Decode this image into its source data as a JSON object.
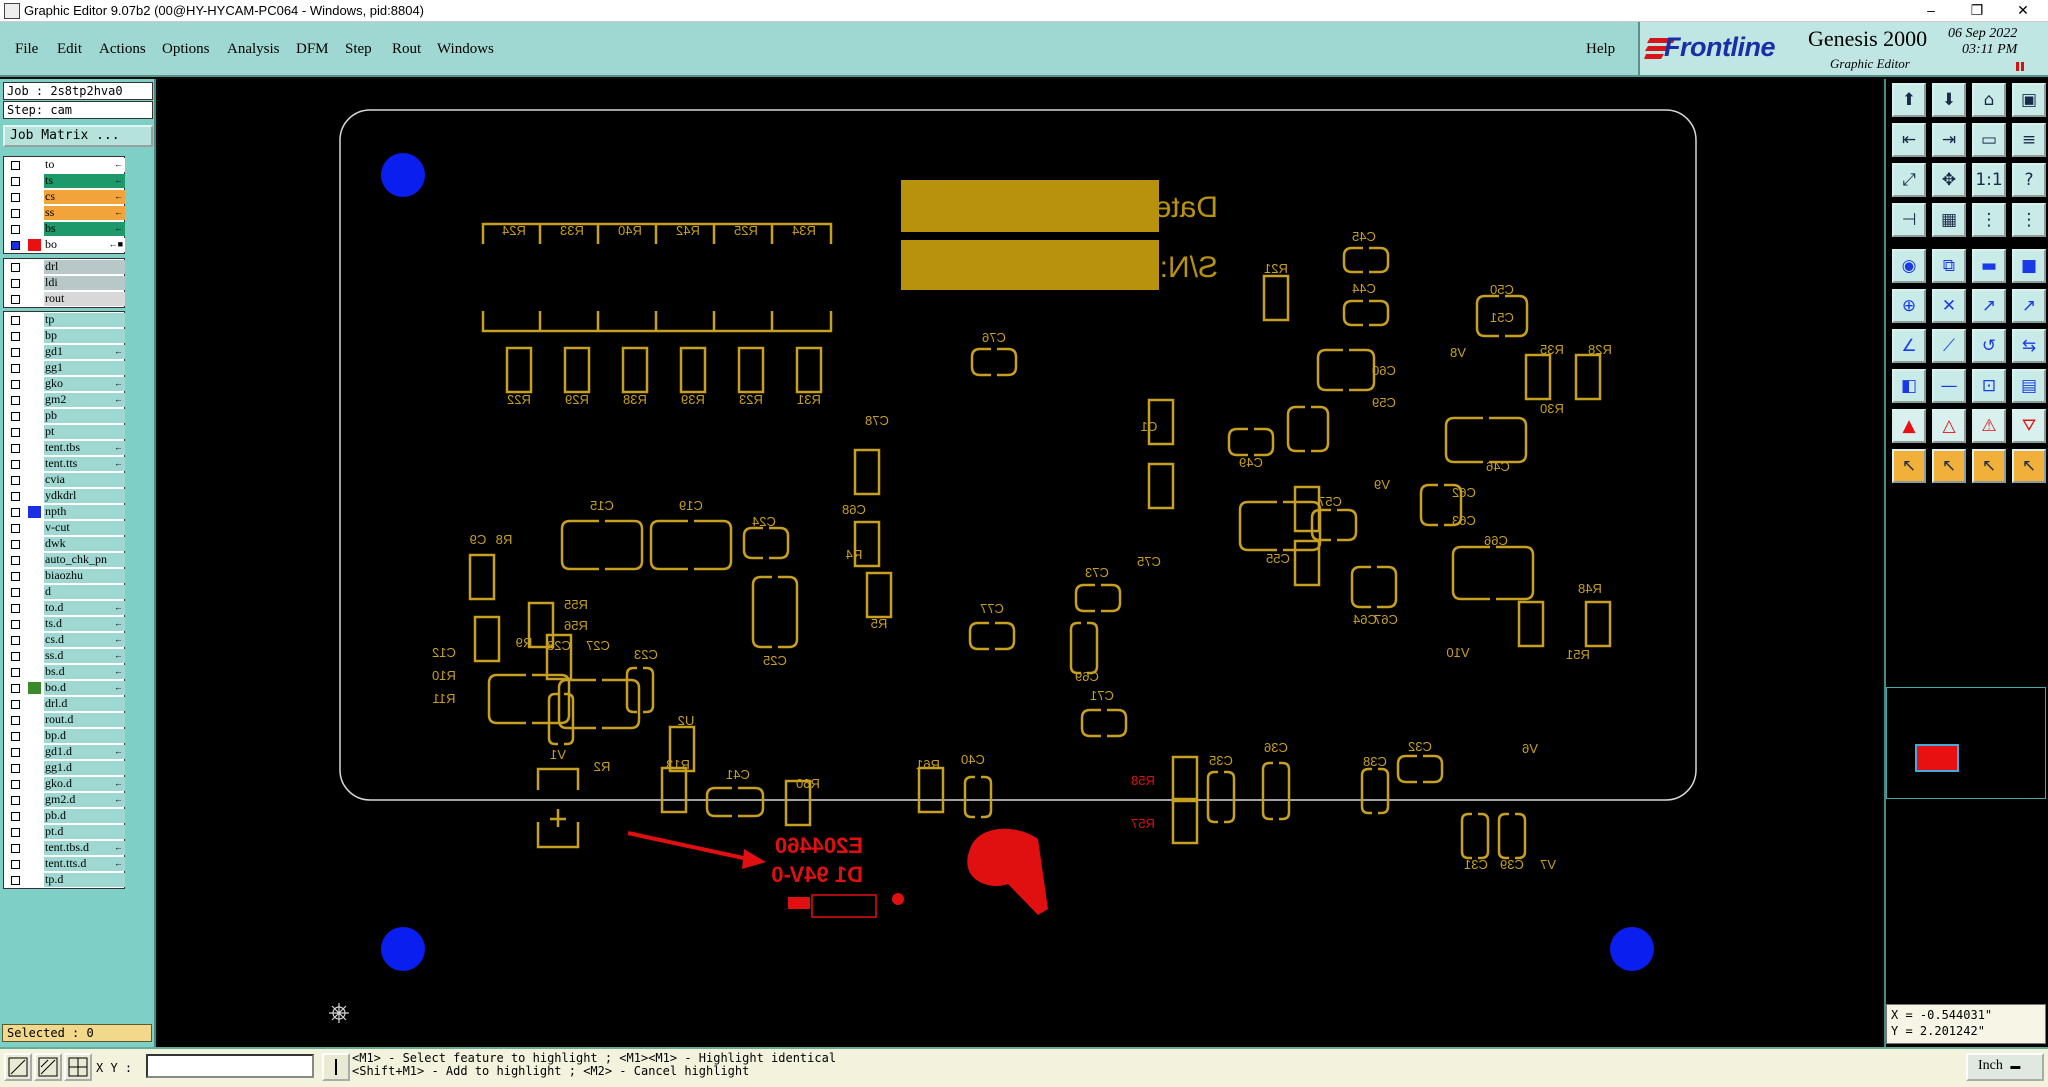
{
  "window": {
    "title": "Graphic Editor 9.07b2 (00@HY-HYCAM-PC064 - Windows, pid:8804)",
    "minimize": "–",
    "restore": "❐",
    "close": "✕"
  },
  "menu": {
    "items": [
      "File",
      "Edit",
      "Actions",
      "Options",
      "Analysis",
      "DFM",
      "Step",
      "Rout",
      "Windows"
    ],
    "help": "Help"
  },
  "brand": {
    "logo": "Frontline",
    "product": "Genesis 2000",
    "subtitle": "Graphic Editor",
    "date": "06 Sep 2022",
    "time": "03:11 PM",
    "pause_icon": "pause-icon"
  },
  "job": {
    "job_label": "Job : 2s8tp2hva0",
    "step_label": "Step: cam",
    "matrix_button": "Job Matrix ..."
  },
  "layers": {
    "group1": [
      {
        "name": "to",
        "color": "#ffffff",
        "flag": "←"
      },
      {
        "name": "ts",
        "color": "#1e9a6a",
        "flag": "←"
      },
      {
        "name": "cs",
        "color": "#f2a43a",
        "flag": "←"
      },
      {
        "name": "ss",
        "color": "#f2a43a",
        "flag": "←"
      },
      {
        "name": "bs",
        "color": "#1e9a6a",
        "flag": "←"
      },
      {
        "name": "bo",
        "color": "#ffffff",
        "flag": "←■",
        "active": true,
        "swatch": "#e81010"
      }
    ],
    "group2": [
      {
        "name": "drl",
        "color": "#b8c8c8"
      },
      {
        "name": "ldi",
        "color": "#b8c8c8"
      },
      {
        "name": "rout",
        "color": "#d8d8d8"
      }
    ],
    "group3": [
      {
        "name": "tp",
        "color": "#9fd8d2",
        "flag": ""
      },
      {
        "name": "bp",
        "color": "#9fd8d2",
        "flag": ""
      },
      {
        "name": "gd1",
        "color": "#9fd8d2",
        "flag": "←"
      },
      {
        "name": "gg1",
        "color": "#9fd8d2",
        "flag": ""
      },
      {
        "name": "gko",
        "color": "#9fd8d2",
        "flag": "←"
      },
      {
        "name": "gm2",
        "color": "#9fd8d2",
        "flag": "←"
      },
      {
        "name": "pb",
        "color": "#9fd8d2",
        "flag": ""
      },
      {
        "name": "pt",
        "color": "#9fd8d2",
        "flag": ""
      },
      {
        "name": "tent.tbs",
        "color": "#9fd8d2",
        "flag": "←"
      },
      {
        "name": "tent.tts",
        "color": "#9fd8d2",
        "flag": "←"
      },
      {
        "name": "cvia",
        "color": "#9fd8d2",
        "flag": ""
      },
      {
        "name": "ydkdrl",
        "color": "#9fd8d2",
        "flag": ""
      },
      {
        "name": "npth",
        "color": "#9fd8d2",
        "flag": "",
        "swatch": "#1a2ee8"
      },
      {
        "name": "v-cut",
        "color": "#9fd8d2",
        "flag": ""
      },
      {
        "name": "dwk",
        "color": "#9fd8d2",
        "flag": ""
      },
      {
        "name": "auto_chk_pn",
        "color": "#9fd8d2",
        "flag": ""
      },
      {
        "name": "biaozhu",
        "color": "#9fd8d2",
        "flag": ""
      },
      {
        "name": "d",
        "color": "#9fd8d2",
        "flag": ""
      },
      {
        "name": "to.d",
        "color": "#9fd8d2",
        "flag": "←"
      },
      {
        "name": "ts.d",
        "color": "#9fd8d2",
        "flag": "←"
      },
      {
        "name": "cs.d",
        "color": "#9fd8d2",
        "flag": "←"
      },
      {
        "name": "ss.d",
        "color": "#9fd8d2",
        "flag": "←"
      },
      {
        "name": "bs.d",
        "color": "#9fd8d2",
        "flag": "←"
      },
      {
        "name": "bo.d",
        "color": "#9fd8d2",
        "flag": "←",
        "swatch": "#3a8a2a"
      },
      {
        "name": "drl.d",
        "color": "#9fd8d2",
        "flag": ""
      },
      {
        "name": "rout.d",
        "color": "#9fd8d2",
        "flag": ""
      },
      {
        "name": "bp.d",
        "color": "#9fd8d2",
        "flag": ""
      },
      {
        "name": "gd1.d",
        "color": "#9fd8d2",
        "flag": "←"
      },
      {
        "name": "gg1.d",
        "color": "#9fd8d2",
        "flag": ""
      },
      {
        "name": "gko.d",
        "color": "#9fd8d2",
        "flag": "←"
      },
      {
        "name": "gm2.d",
        "color": "#9fd8d2",
        "flag": "←"
      },
      {
        "name": "pb.d",
        "color": "#9fd8d2",
        "flag": ""
      },
      {
        "name": "pt.d",
        "color": "#9fd8d2",
        "flag": ""
      },
      {
        "name": "tent.tbs.d",
        "color": "#9fd8d2",
        "flag": "←"
      },
      {
        "name": "tent.tts.d",
        "color": "#9fd8d2",
        "flag": "←"
      },
      {
        "name": "tp.d",
        "color": "#9fd8d2",
        "flag": ""
      }
    ]
  },
  "selected": "Selected : 0",
  "toolbar": {
    "icons": [
      "open-job-icon",
      "save-icon",
      "home-icon",
      "window-icon",
      "zoom-in-icon",
      "zoom-out-icon",
      "zoom-prev-icon",
      "zoom-next-icon",
      "fit-icon",
      "center-icon",
      "scale-icon",
      "help-icon",
      "measure-icon",
      "grid-icon",
      "snap-icon",
      "filter-icon",
      "select-icon",
      "copy-icon",
      "line-icon",
      "pad-icon",
      "connect-icon",
      "cross-icon",
      "move-icon",
      "arc-icon",
      "angle-icon",
      "slope-icon",
      "undo-icon",
      "transfer-icon",
      "pad-select-icon",
      "minus-icon",
      "step-icon",
      "array-icon",
      "tri-red-icon",
      "tri-open-icon",
      "tri-mark-icon",
      "tri-stop-icon",
      "pointer-icon",
      "pointer-move-icon",
      "pointer-rotate-icon",
      "pointer-drag-icon"
    ]
  },
  "coords": {
    "x": "X = -0.544031\"",
    "y": "Y = 2.201242\""
  },
  "statusbar": {
    "xy_label": "X Y :",
    "xy_value": "",
    "message": "<M1> - Select feature to highlight ; <M1><M1> - Highlight identical\n<Shift+M1> - Add to highlight ; <M2> - Cancel highlight",
    "unit": "Inch"
  },
  "board": {
    "date_label": "Date:",
    "sn_label": "S/N:",
    "ul_code": "E204460",
    "ul_rating": "D1 94V-0",
    "refdes": [
      "R24",
      "R33",
      "R40",
      "R42",
      "R25",
      "R34",
      "R22",
      "R29",
      "R38",
      "R39",
      "R23",
      "R31",
      "C45",
      "C44",
      "R21",
      "C50",
      "C51",
      "V8",
      "R35",
      "R28",
      "R30",
      "C60",
      "C59",
      "C76",
      "C78",
      "C1",
      "C49",
      "C46",
      "C62",
      "C63",
      "C66",
      "C68",
      "R4",
      "C75",
      "C55",
      "C57",
      "V9",
      "C9",
      "R8",
      "C15",
      "C19",
      "C24",
      "C64",
      "C67",
      "R48",
      "R51",
      "V10",
      "R55",
      "R56",
      "C73",
      "R5",
      "C25",
      "C77",
      "C69",
      "C12",
      "R9",
      "C28",
      "C27",
      "C23",
      "R10",
      "R11",
      "U2",
      "R13",
      "C71",
      "V1",
      "R2",
      "C41",
      "R60",
      "R61",
      "C40",
      "C35",
      "C36",
      "C38",
      "C32",
      "V6",
      "R58",
      "R57",
      "C31",
      "C39",
      "V7"
    ]
  }
}
